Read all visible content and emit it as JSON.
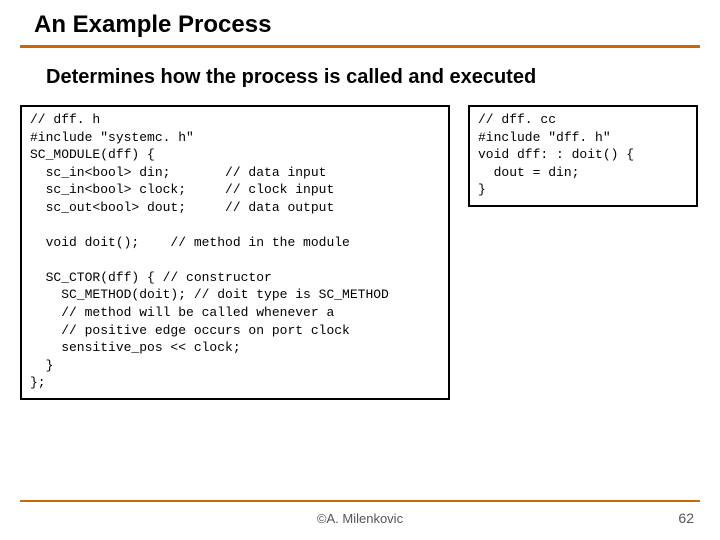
{
  "title": "An Example Process",
  "subtitle": "Determines how the process is called and executed",
  "code_left": "// dff. h\n#include \"systemc. h\"\nSC_MODULE(dff) {\n  sc_in<bool> din;       // data input\n  sc_in<bool> clock;     // clock input\n  sc_out<bool> dout;     // data output\n\n  void doit();    // method in the module\n\n  SC_CTOR(dff) { // constructor\n    SC_METHOD(doit); // doit type is SC_METHOD\n    // method will be called whenever a\n    // positive edge occurs on port clock\n    sensitive_pos << clock;\n  }\n};",
  "code_right": "// dff. cc\n#include \"dff. h\"\nvoid dff: : doit() {\n  dout = din;\n}",
  "footer_center": "©A. Milenkovic",
  "footer_right": "62"
}
